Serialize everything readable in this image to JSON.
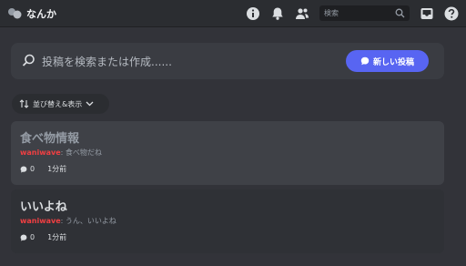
{
  "app": {
    "title": "なんか"
  },
  "search": {
    "placeholder": "検索"
  },
  "icons": {
    "logo": "threads-logo-icon",
    "info": "info-icon",
    "bell": "bell-icon",
    "members": "members-icon",
    "search": "search-icon",
    "inbox": "inbox-icon",
    "help": "help-icon"
  },
  "composer": {
    "placeholder": "投稿を検索または作成......",
    "new_post_label": "新しい投稿"
  },
  "sort": {
    "label": "並び替え&表示"
  },
  "posts": [
    {
      "title": "食べ物情報",
      "author": "waniwave",
      "preview": "食べ物だね",
      "replies": "0",
      "time": "1分前"
    },
    {
      "title": "いいよね",
      "author": "waniwave",
      "preview": "うん、いいよね",
      "replies": "0",
      "time": "1分前"
    }
  ],
  "colors": {
    "accent": "#5865f2",
    "author": "#f23f42",
    "background": "#323339"
  }
}
